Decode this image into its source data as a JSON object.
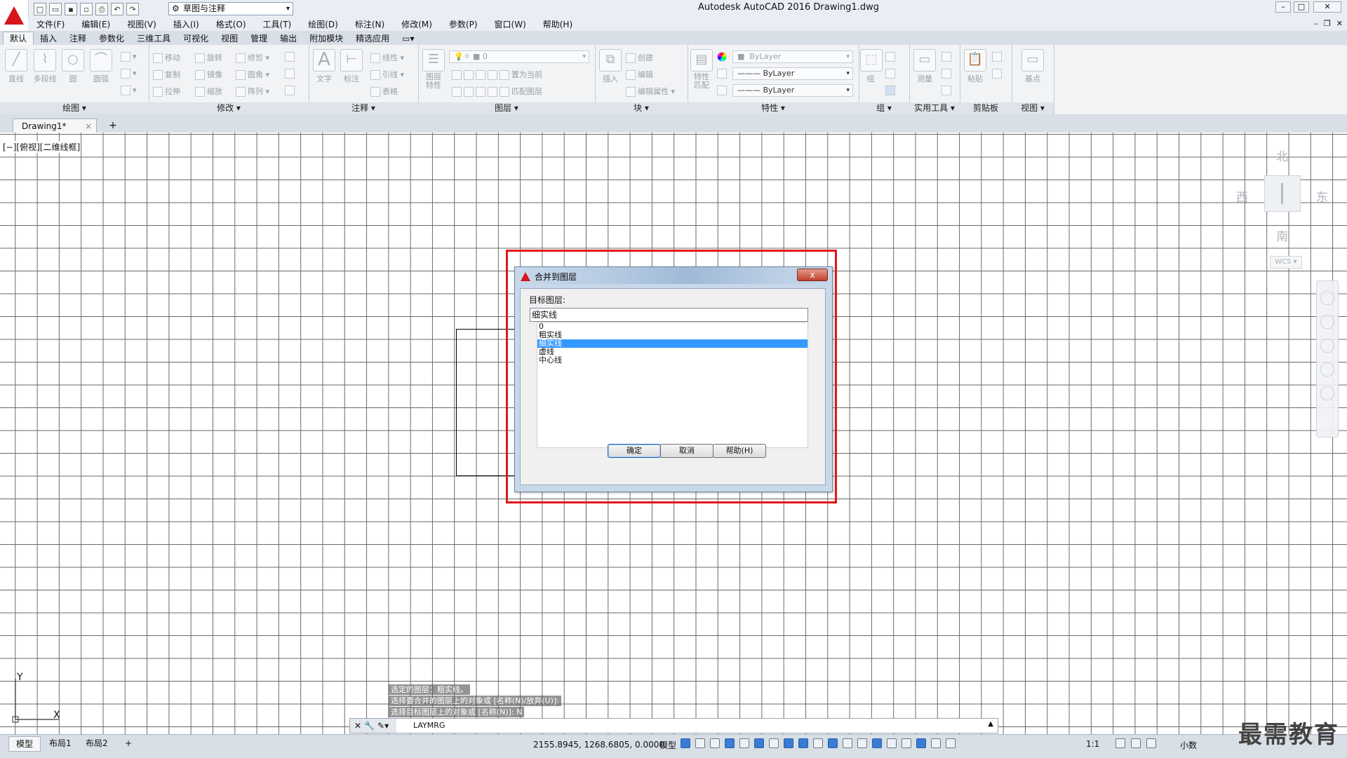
{
  "app": {
    "title": "Autodesk AutoCAD 2016    Drawing1.dwg",
    "workspace": "草图与注释"
  },
  "menus": [
    "文件(F)",
    "编辑(E)",
    "视图(V)",
    "插入(I)",
    "格式(O)",
    "工具(T)",
    "绘图(D)",
    "标注(N)",
    "修改(M)",
    "参数(P)",
    "窗口(W)",
    "帮助(H)"
  ],
  "ribbon_tabs": [
    "默认",
    "插入",
    "注释",
    "参数化",
    "三维工具",
    "可视化",
    "视图",
    "管理",
    "输出",
    "附加模块",
    "精选应用"
  ],
  "ribbon": {
    "draw": {
      "title": "绘图",
      "line": "直线",
      "polyline": "多段线",
      "circle": "圆",
      "arc": "圆弧"
    },
    "modify": {
      "title": "修改",
      "move": "移动",
      "rotate": "旋转",
      "trim": "修剪",
      "copy": "复制",
      "mirror": "镜像",
      "fillet": "圆角",
      "stretch": "拉伸",
      "scale": "缩放",
      "array": "阵列"
    },
    "annotation": {
      "title": "注释",
      "text": "文字",
      "dimension": "标注",
      "linear": "线性",
      "leader": "引线",
      "table": "表格"
    },
    "layers": {
      "title": "图层",
      "properties": "图层特性",
      "current_layer": "0",
      "set_current": "置为当前",
      "match": "匹配图层"
    },
    "block": {
      "title": "块",
      "insert": "插入",
      "create": "创建",
      "edit": "编辑",
      "edit_attr": "编辑属性"
    },
    "properties": {
      "title": "特性",
      "match": "特性匹配",
      "color": "ByLayer",
      "linetype": "ByLayer",
      "lineweight": "ByLayer"
    },
    "groups": {
      "title": "组",
      "group": "组"
    },
    "utilities": {
      "title": "实用工具",
      "measure": "测量"
    },
    "clipboard": {
      "title": "剪贴板",
      "paste": "粘贴"
    },
    "view": {
      "title": "视图",
      "base": "基点"
    }
  },
  "doc_tab": {
    "label": "Drawing1*",
    "close": "×",
    "add": "+"
  },
  "viewport_label": "[−][俯视][二维线框]",
  "viewcube": {
    "north": "北",
    "south": "南",
    "east": "东",
    "west": "西",
    "wcs": "WCS"
  },
  "ucs": {
    "y": "Y",
    "x": "X"
  },
  "dialog": {
    "title": "合并到图层",
    "close": "x",
    "target_label": "目标图层:",
    "target_value": "细实线",
    "layers": [
      {
        "name": "0",
        "selected": false
      },
      {
        "name": "粗实线",
        "selected": false
      },
      {
        "name": "细实线",
        "selected": true
      },
      {
        "name": "虚线",
        "selected": false
      },
      {
        "name": "中心线",
        "selected": false
      }
    ],
    "ok": "确定",
    "cancel": "取消",
    "help": "帮助(H)"
  },
  "command_history": [
    "选定的图层：粗实线。",
    "选择要合并的图层上的对象或 [名称(N)/放弃(U)]:",
    "选择目标图层上的对象或 [名称(N)]: N"
  ],
  "command_line": {
    "text": "LAYMRG"
  },
  "layout_tabs": [
    "模型",
    "布局1",
    "布局2"
  ],
  "status": {
    "coords": "2155.8945, 1268.6805, 0.0000",
    "model": "模型",
    "scale": "1:1",
    "units": "小数"
  },
  "watermark": "最需教育",
  "colors": {
    "accent": "#3399ff",
    "highlight": "#e3161b",
    "brand": "#d9141b"
  }
}
